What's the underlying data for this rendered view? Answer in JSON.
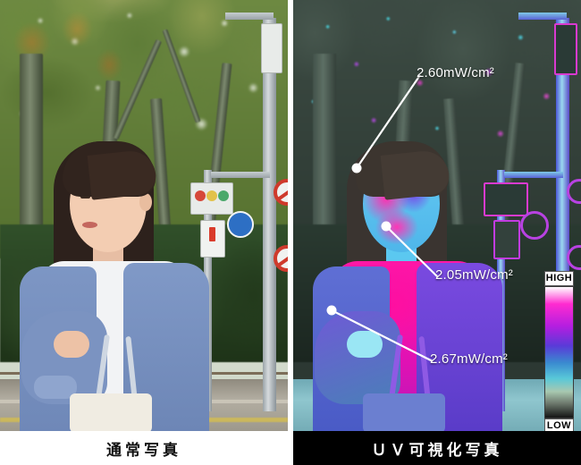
{
  "figure": {
    "panels": [
      {
        "id": "normal",
        "caption": "通常写真"
      },
      {
        "id": "uv",
        "caption": "ＵＶ可視化写真"
      }
    ]
  },
  "annotations": [
    {
      "id": "cheek",
      "value": "2.60",
      "unit": "mW/cm",
      "exponent": "2",
      "text": "2.60mW/cm²"
    },
    {
      "id": "chest",
      "value": "2.05",
      "unit": "mW/cm",
      "exponent": "2",
      "text": "2.05mW/cm²"
    },
    {
      "id": "hand",
      "value": "2.67",
      "unit": "mW/cm",
      "exponent": "2",
      "text": "2.67mW/cm²"
    }
  ],
  "scale": {
    "high_label": "HIGH",
    "low_label": "LOW",
    "colors": {
      "high": "#ffffff",
      "magenta": "#ff2bd0",
      "purple": "#b41ee0",
      "blue": "#5a3ad8",
      "cyan": "#58c8d8",
      "low": "#141414"
    }
  },
  "scene": {
    "normal": {
      "subject": "woman-with-blue-cardigan",
      "elements": [
        "tree-canopy",
        "traffic-signal",
        "pedestrian-signal",
        "blue-round-sign",
        "red-round-sign",
        "hedge",
        "guardrail",
        "road"
      ]
    },
    "uv": {
      "subject": "woman-false-color",
      "elements": [
        "tree-canopy",
        "traffic-signal",
        "pedestrian-signal",
        "hedge",
        "road"
      ]
    }
  }
}
